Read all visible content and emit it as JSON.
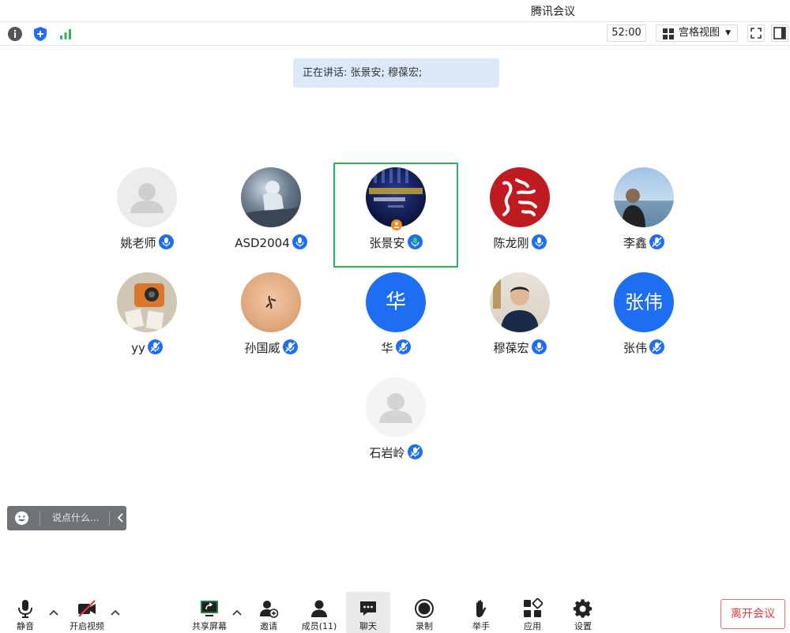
{
  "window": {
    "title": "腾讯会议"
  },
  "topbar": {
    "timer": "52:00",
    "view_mode": "宫格视图",
    "icons": [
      "info-icon",
      "shield-icon",
      "signal-icon",
      "grid-icon",
      "fullscreen-icon",
      "sidebar-icon"
    ]
  },
  "banner": {
    "speaking_text": "正在讲话: 张景安; 穆葆宏;"
  },
  "participants": [
    {
      "name": "姚老师",
      "avatar": "default-avatar",
      "mic": "mic-on-icon"
    },
    {
      "name": "ASD2004",
      "avatar": "astronaut-photo",
      "mic": "mic-on-icon"
    },
    {
      "name": "张景安",
      "avatar": "screen-photo",
      "mic": "mic-speaking-icon",
      "active": true
    },
    {
      "name": "陈龙刚",
      "avatar": "calligraphy-photo",
      "mic": "mic-on-icon"
    },
    {
      "name": "李鑫",
      "avatar": "seaside-photo",
      "mic": "mic-muted-icon"
    },
    {
      "name": "yy",
      "avatar": "camera-photo",
      "mic": "mic-muted-icon"
    },
    {
      "name": "孙国威",
      "avatar": "sand-photo",
      "mic": "mic-muted-icon"
    },
    {
      "name": "华",
      "avatar_text": "华",
      "mic": "mic-muted-icon"
    },
    {
      "name": "穆葆宏",
      "avatar": "portrait-photo",
      "mic": "mic-on-icon"
    },
    {
      "name": "张伟",
      "avatar_text": "张伟",
      "mic": "mic-muted-icon"
    },
    {
      "name": "石岩岭",
      "avatar": "default-avatar",
      "mic": "mic-muted-icon"
    }
  ],
  "chat": {
    "placeholder": "说点什么..."
  },
  "bottombar": {
    "mute": "静音",
    "video": "开启视频",
    "share": "共享屏幕",
    "invite": "邀请",
    "members": "成员(11)",
    "chat": "聊天",
    "record": "录制",
    "raise_hand": "举手",
    "apps": "应用",
    "settings": "设置",
    "leave": "离开会议"
  },
  "colors": {
    "accent": "#1d6ef2",
    "active_border": "#2fb456",
    "leave": "#e0383e",
    "banner": "#dbe9fb"
  }
}
